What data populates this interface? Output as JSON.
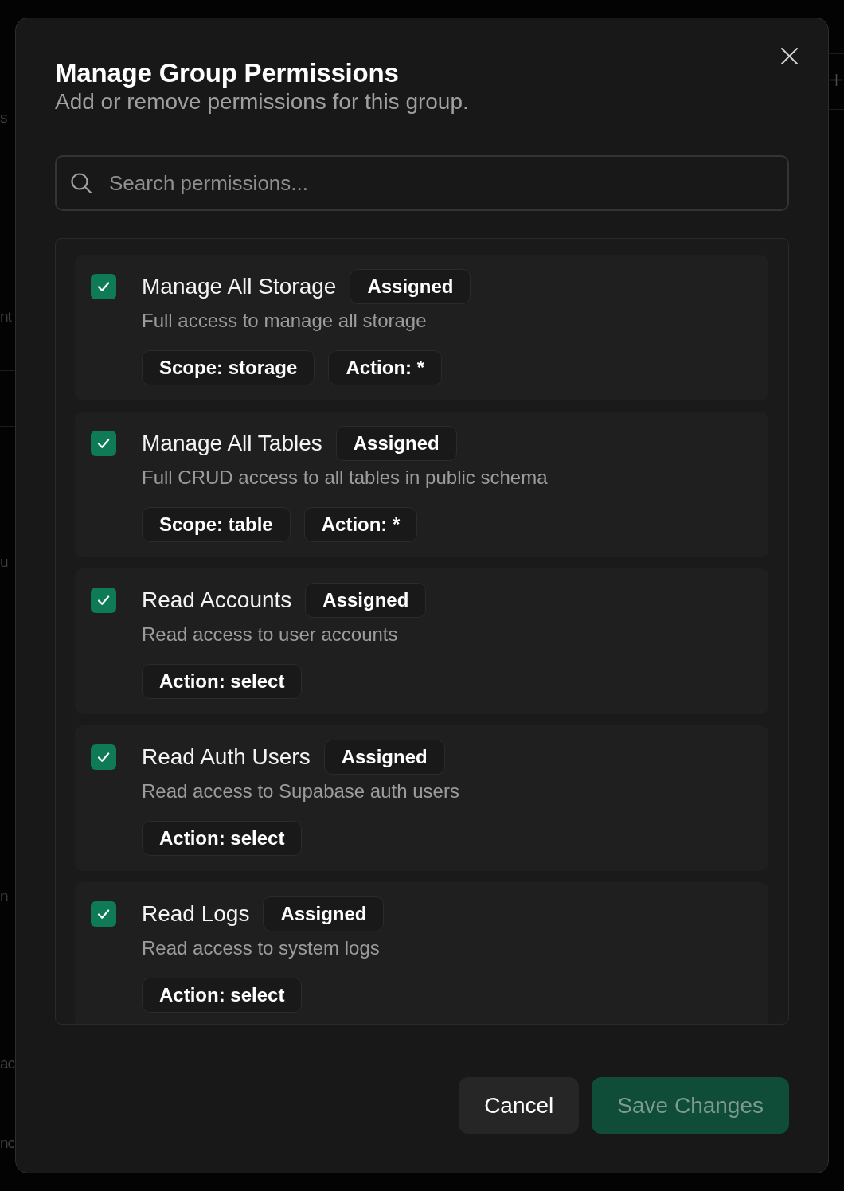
{
  "backdrop": {
    "fragments": [
      "s",
      "nt",
      "u",
      "n",
      "ac",
      "nc"
    ]
  },
  "dialog": {
    "title": "Manage Group Permissions",
    "subtitle": "Add or remove permissions for this group."
  },
  "search": {
    "placeholder": "Search permissions..."
  },
  "permissions": [
    {
      "name": "Manage All Storage",
      "badge": "Assigned",
      "checked": true,
      "description": "Full access to manage all storage",
      "tags": [
        "Scope: storage",
        "Action: *"
      ]
    },
    {
      "name": "Manage All Tables",
      "badge": "Assigned",
      "checked": true,
      "description": "Full CRUD access to all tables in public schema",
      "tags": [
        "Scope: table",
        "Action: *"
      ]
    },
    {
      "name": "Read Accounts",
      "badge": "Assigned",
      "checked": true,
      "description": "Read access to user accounts",
      "tags": [
        "Action: select"
      ]
    },
    {
      "name": "Read Auth Users",
      "badge": "Assigned",
      "checked": true,
      "description": "Read access to Supabase auth users",
      "tags": [
        "Action: select"
      ]
    },
    {
      "name": "Read Logs",
      "badge": "Assigned",
      "checked": true,
      "description": "Read access to system logs",
      "tags": [
        "Action: select"
      ]
    }
  ],
  "buttons": [
    {
      "label": "Cancel",
      "kind": "secondary",
      "disabled": false
    },
    {
      "label": "Save Changes",
      "kind": "primary",
      "disabled": true
    }
  ]
}
